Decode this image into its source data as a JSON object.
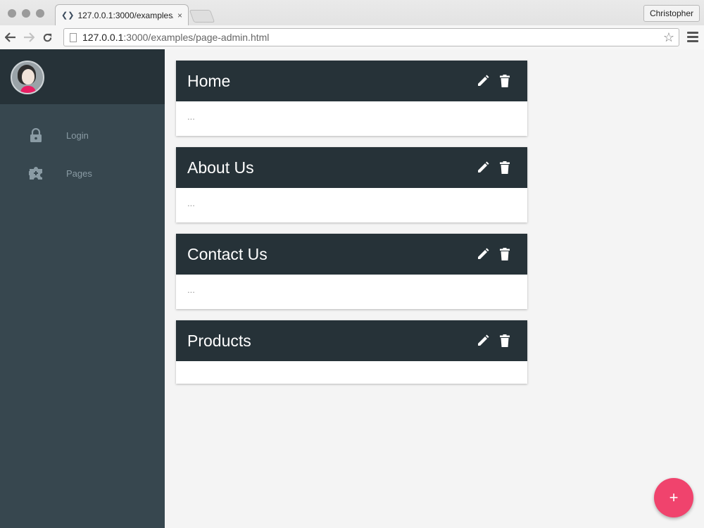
{
  "browser": {
    "tab_title": "127.0.0.1:3000/examples/",
    "tab_close": "×",
    "user_button": "Christopher",
    "url_host": "127.0.0.1",
    "url_path": ":3000/examples/page-admin.html"
  },
  "sidebar": {
    "items": [
      {
        "label": "Login",
        "icon": "lock-icon"
      },
      {
        "label": "Pages",
        "icon": "extension-icon"
      }
    ]
  },
  "pages": [
    {
      "title": "Home",
      "body": "..."
    },
    {
      "title": "About Us",
      "body": "..."
    },
    {
      "title": "Contact Us",
      "body": "..."
    },
    {
      "title": "Products",
      "body": ""
    }
  ],
  "fab": {
    "label": "+"
  },
  "colors": {
    "sidebar_bg": "#37474f",
    "header_bg": "#263238",
    "accent": "#f0436d"
  }
}
